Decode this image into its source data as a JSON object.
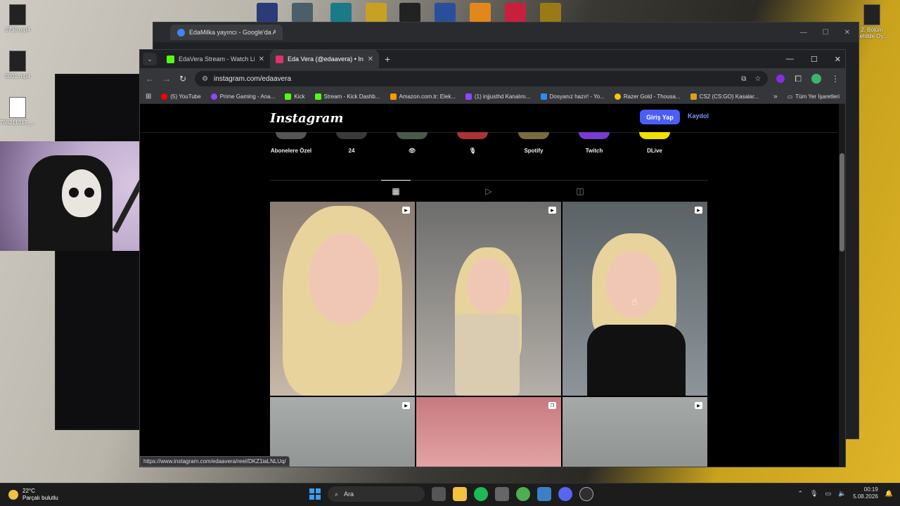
{
  "desktop": {
    "icons": [
      {
        "label": "0730.mp4"
      },
      {
        "label": "0801.mp4"
      },
      {
        "label": "768211317_..."
      },
      {
        "label": "2. Bölüm Şehilde Oy..."
      }
    ]
  },
  "back_window": {
    "tab_title": "EdaMilka yayıncı - Google'da A"
  },
  "browser": {
    "tabs": [
      {
        "title": "EdaVera Stream - Watch Live o",
        "color": "#53fc18"
      },
      {
        "title": "Eda Vera (@edaavera) • Instag",
        "color": "#e1306c"
      }
    ],
    "url": "instagram.com/edaavera",
    "bookmarks": [
      {
        "label": "(5) YouTube",
        "color": "#ff0000"
      },
      {
        "label": "Prime Gaming - Ana...",
        "color": "#9146ff"
      },
      {
        "label": "Kick",
        "color": "#53fc18"
      },
      {
        "label": "Stream - Kick Dashb...",
        "color": "#53fc18"
      },
      {
        "label": "Amazon.com.tr: Elek...",
        "color": "#ff9900"
      },
      {
        "label": "(1) injjusthd Kanalını...",
        "color": "#9146ff"
      },
      {
        "label": "Dosyanız hazır! - Yo...",
        "color": "#2d8cf0"
      },
      {
        "label": "Razer Gold - Thousa...",
        "color": "#f5c518"
      },
      {
        "label": "CS2 (CS:GO) Kasalar...",
        "color": "#d8a01c"
      }
    ],
    "all_bookmarks": "Tüm Yer İşaretleri",
    "status_url": "https://www.instagram.com/edaavera/reel/DKZ1iaLNLUq/"
  },
  "instagram": {
    "logo": "Instagram",
    "login": "Giriş Yap",
    "signup": "Kaydol",
    "highlights": [
      {
        "label": "Abonelere Özel"
      },
      {
        "label": "24"
      },
      {
        "label": "👁"
      },
      {
        "label": "🎙"
      },
      {
        "label": "Spotify"
      },
      {
        "label": "Twitch"
      },
      {
        "label": "DLive"
      }
    ]
  },
  "taskbar": {
    "temperature": "22°C",
    "weather": "Parçalı bulutlu",
    "search": "Ara",
    "time": "00:19",
    "date": "5.08.2026"
  }
}
